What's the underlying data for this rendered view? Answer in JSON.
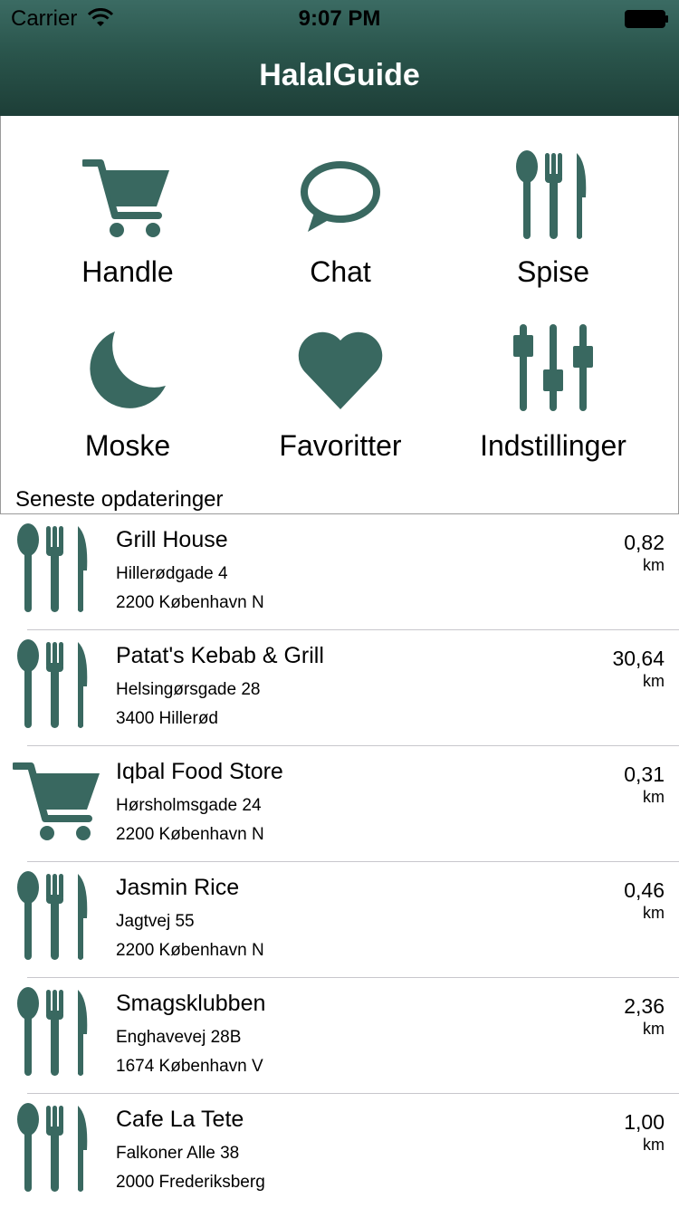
{
  "colors": {
    "accent": "#396860",
    "nav_top": "#3b6b63",
    "nav_bottom": "#1d3e37"
  },
  "status_bar": {
    "carrier": "Carrier",
    "time": "9:07 PM"
  },
  "nav": {
    "title": "HalalGuide"
  },
  "menu": [
    {
      "label": "Handle",
      "icon": "cart-icon"
    },
    {
      "label": "Chat",
      "icon": "chat-bubble-icon"
    },
    {
      "label": "Spise",
      "icon": "cutlery-icon"
    },
    {
      "label": "Moske",
      "icon": "crescent-moon-icon"
    },
    {
      "label": "Favoritter",
      "icon": "heart-icon"
    },
    {
      "label": "Indstillinger",
      "icon": "sliders-icon"
    }
  ],
  "section_header": "Seneste opdateringer",
  "places": [
    {
      "name": "Grill House",
      "street": "Hillerødgade 4",
      "city": "2200 København N",
      "distance": "0,82",
      "unit": "km",
      "icon": "cutlery-icon"
    },
    {
      "name": "Patat's Kebab & Grill",
      "street": "Helsingørsgade 28",
      "city": "3400 Hillerød",
      "distance": "30,64",
      "unit": "km",
      "icon": "cutlery-icon"
    },
    {
      "name": "Iqbal Food Store",
      "street": "Hørsholmsgade 24",
      "city": "2200 København N",
      "distance": "0,31",
      "unit": "km",
      "icon": "cart-icon"
    },
    {
      "name": "Jasmin Rice",
      "street": "Jagtvej 55",
      "city": "2200 København N",
      "distance": "0,46",
      "unit": "km",
      "icon": "cutlery-icon"
    },
    {
      "name": "Smagsklubben",
      "street": "Enghavevej 28B",
      "city": "1674 København V",
      "distance": "2,36",
      "unit": "km",
      "icon": "cutlery-icon"
    },
    {
      "name": "Cafe La Tete",
      "street": "Falkoner Alle 38",
      "city": "2000 Frederiksberg",
      "distance": "1,00",
      "unit": "km",
      "icon": "cutlery-icon"
    }
  ]
}
